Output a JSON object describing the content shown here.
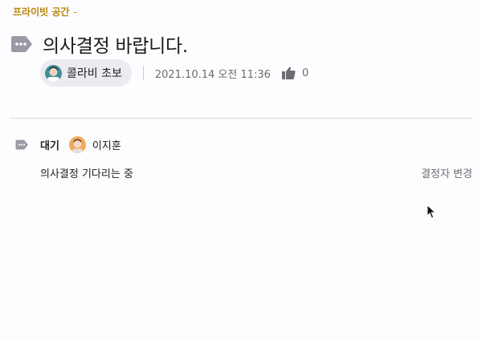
{
  "breadcrumb": {
    "space": "프라이빗 공간",
    "separator": "-"
  },
  "post": {
    "title": "의사결정 바랍니다.",
    "author": "콜라비 초보",
    "datetime": "2021.10.14 오전 11:36",
    "likes": "0"
  },
  "decision": {
    "status": "대기",
    "assignee": "이지훈",
    "description": "의사결정 기다리는 중",
    "change_label": "결정자 변경"
  },
  "colors": {
    "accent": "#b8860b",
    "tag_icon": "#9a9aa6",
    "chip_bg": "#ecebef"
  }
}
